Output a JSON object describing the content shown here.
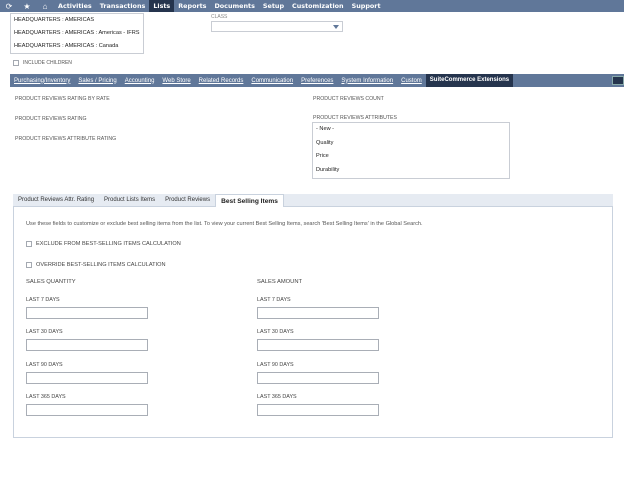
{
  "topnav": {
    "icons": [
      "recent-icon",
      "star-icon",
      "home-icon"
    ],
    "items": [
      {
        "label": "Activities",
        "active": false
      },
      {
        "label": "Transactions",
        "active": false
      },
      {
        "label": "Lists",
        "active": true
      },
      {
        "label": "Reports",
        "active": false
      },
      {
        "label": "Documents",
        "active": false
      },
      {
        "label": "Setup",
        "active": false
      },
      {
        "label": "Customization",
        "active": false
      },
      {
        "label": "Support",
        "active": false
      }
    ]
  },
  "subsidiary": {
    "options": [
      "HEADQUARTERS : AMERICAS",
      "HEADQUARTERS : AMERICAS : Americas - IFRS",
      "HEADQUARTERS : AMERICAS : Canada"
    ],
    "include_children_label": "INCLUDE CHILDREN"
  },
  "class_field": {
    "label": "CLASS",
    "value": ""
  },
  "subtabs": [
    {
      "label": "Purchasing/Inventory",
      "active": false
    },
    {
      "label": "Sales / Pricing",
      "active": false
    },
    {
      "label": "Accounting",
      "active": false
    },
    {
      "label": "Web Store",
      "active": false
    },
    {
      "label": "Related Records",
      "active": false
    },
    {
      "label": "Communication",
      "active": false
    },
    {
      "label": "Preferences",
      "active": false
    },
    {
      "label": "System Information",
      "active": false
    },
    {
      "label": "Custom",
      "active": false
    },
    {
      "label": "SuiteCommerce Extensions",
      "active": true
    }
  ],
  "reviews": {
    "rating_by_rate_label": "PRODUCT REVIEWS RATING BY RATE",
    "rating_label": "PRODUCT REVIEWS RATING",
    "attr_rating_label": "PRODUCT REVIEWS ATTRIBUTE RATING",
    "count_label": "PRODUCT REVIEWS COUNT",
    "attributes_label": "PRODUCT REVIEWS ATTRIBUTES",
    "attributes_options": [
      "- New -",
      "Quality",
      "Price",
      "Durability"
    ]
  },
  "inner_tabs": [
    {
      "label": "Product Reviews Attr. Rating",
      "active": false
    },
    {
      "label": "Product Lists Items",
      "active": false
    },
    {
      "label": "Product Reviews",
      "active": false
    },
    {
      "label": "Best Selling Items",
      "active": true
    }
  ],
  "best_selling": {
    "help_text": "Use these fields to customize or exclude best selling items from the list. To view your current Best Selling Items, search 'Best Selling Items' in the Global Search.",
    "exclude_label": "EXCLUDE FROM BEST-SELLING ITEMS CALCULATION",
    "override_label": "OVERRIDE BEST-SELLING ITEMS CALCULATION",
    "quantity_header": "SALES QUANTITY",
    "amount_header": "SALES AMOUNT",
    "periods": [
      "LAST 7 DAYS",
      "LAST 30 DAYS",
      "LAST 90 DAYS",
      "LAST 365 DAYS"
    ],
    "quantity_values": [
      "",
      "",
      "",
      ""
    ],
    "amount_values": [
      "",
      "",
      "",
      ""
    ]
  },
  "colors": {
    "nav": "#607799",
    "nav_active": "#25344d",
    "tab_bg": "#e6ebf2"
  }
}
